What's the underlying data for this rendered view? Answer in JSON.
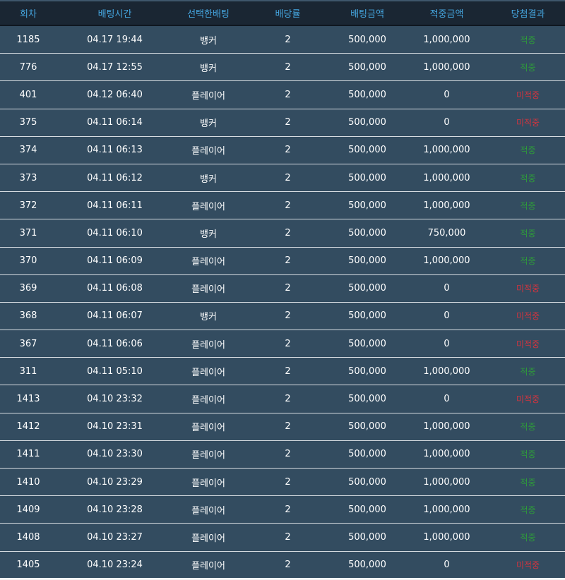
{
  "colors": {
    "header_bg": "#1a2633",
    "header_text": "#45a6e0",
    "row_bg": "#334c60",
    "row_border": "#d8dde2",
    "win": "#2e9b3a",
    "lose": "#d0343f"
  },
  "headers": [
    "회차",
    "배팅시간",
    "선택한배팅",
    "배당률",
    "배팅금액",
    "적중금액",
    "당첨결과"
  ],
  "rows": [
    {
      "round": "1185",
      "time": "04.17 19:44",
      "pick": "뱅커",
      "odds": "2",
      "bet": "500,000",
      "payout": "1,000,000",
      "result": "적중",
      "status": "win"
    },
    {
      "round": "776",
      "time": "04.17 12:55",
      "pick": "뱅커",
      "odds": "2",
      "bet": "500,000",
      "payout": "1,000,000",
      "result": "적중",
      "status": "win"
    },
    {
      "round": "401",
      "time": "04.12 06:40",
      "pick": "플레이어",
      "odds": "2",
      "bet": "500,000",
      "payout": "0",
      "result": "미적중",
      "status": "lose"
    },
    {
      "round": "375",
      "time": "04.11 06:14",
      "pick": "뱅커",
      "odds": "2",
      "bet": "500,000",
      "payout": "0",
      "result": "미적중",
      "status": "lose"
    },
    {
      "round": "374",
      "time": "04.11 06:13",
      "pick": "플레이어",
      "odds": "2",
      "bet": "500,000",
      "payout": "1,000,000",
      "result": "적중",
      "status": "win"
    },
    {
      "round": "373",
      "time": "04.11 06:12",
      "pick": "뱅커",
      "odds": "2",
      "bet": "500,000",
      "payout": "1,000,000",
      "result": "적중",
      "status": "win"
    },
    {
      "round": "372",
      "time": "04.11 06:11",
      "pick": "플레이어",
      "odds": "2",
      "bet": "500,000",
      "payout": "1,000,000",
      "result": "적중",
      "status": "win"
    },
    {
      "round": "371",
      "time": "04.11 06:10",
      "pick": "뱅커",
      "odds": "2",
      "bet": "500,000",
      "payout": "750,000",
      "result": "적중",
      "status": "win"
    },
    {
      "round": "370",
      "time": "04.11 06:09",
      "pick": "플레이어",
      "odds": "2",
      "bet": "500,000",
      "payout": "1,000,000",
      "result": "적중",
      "status": "win"
    },
    {
      "round": "369",
      "time": "04.11 06:08",
      "pick": "플레이어",
      "odds": "2",
      "bet": "500,000",
      "payout": "0",
      "result": "미적중",
      "status": "lose"
    },
    {
      "round": "368",
      "time": "04.11 06:07",
      "pick": "뱅커",
      "odds": "2",
      "bet": "500,000",
      "payout": "0",
      "result": "미적중",
      "status": "lose"
    },
    {
      "round": "367",
      "time": "04.11 06:06",
      "pick": "플레이어",
      "odds": "2",
      "bet": "500,000",
      "payout": "0",
      "result": "미적중",
      "status": "lose"
    },
    {
      "round": "311",
      "time": "04.11 05:10",
      "pick": "플레이어",
      "odds": "2",
      "bet": "500,000",
      "payout": "1,000,000",
      "result": "적중",
      "status": "win"
    },
    {
      "round": "1413",
      "time": "04.10 23:32",
      "pick": "플레이어",
      "odds": "2",
      "bet": "500,000",
      "payout": "0",
      "result": "미적중",
      "status": "lose"
    },
    {
      "round": "1412",
      "time": "04.10 23:31",
      "pick": "플레이어",
      "odds": "2",
      "bet": "500,000",
      "payout": "1,000,000",
      "result": "적중",
      "status": "win"
    },
    {
      "round": "1411",
      "time": "04.10 23:30",
      "pick": "플레이어",
      "odds": "2",
      "bet": "500,000",
      "payout": "1,000,000",
      "result": "적중",
      "status": "win"
    },
    {
      "round": "1410",
      "time": "04.10 23:29",
      "pick": "플레이어",
      "odds": "2",
      "bet": "500,000",
      "payout": "1,000,000",
      "result": "적중",
      "status": "win"
    },
    {
      "round": "1409",
      "time": "04.10 23:28",
      "pick": "플레이어",
      "odds": "2",
      "bet": "500,000",
      "payout": "1,000,000",
      "result": "적중",
      "status": "win"
    },
    {
      "round": "1408",
      "time": "04.10 23:27",
      "pick": "플레이어",
      "odds": "2",
      "bet": "500,000",
      "payout": "1,000,000",
      "result": "적중",
      "status": "win"
    },
    {
      "round": "1405",
      "time": "04.10 23:24",
      "pick": "플레이어",
      "odds": "2",
      "bet": "500,000",
      "payout": "0",
      "result": "미적중",
      "status": "lose"
    }
  ]
}
